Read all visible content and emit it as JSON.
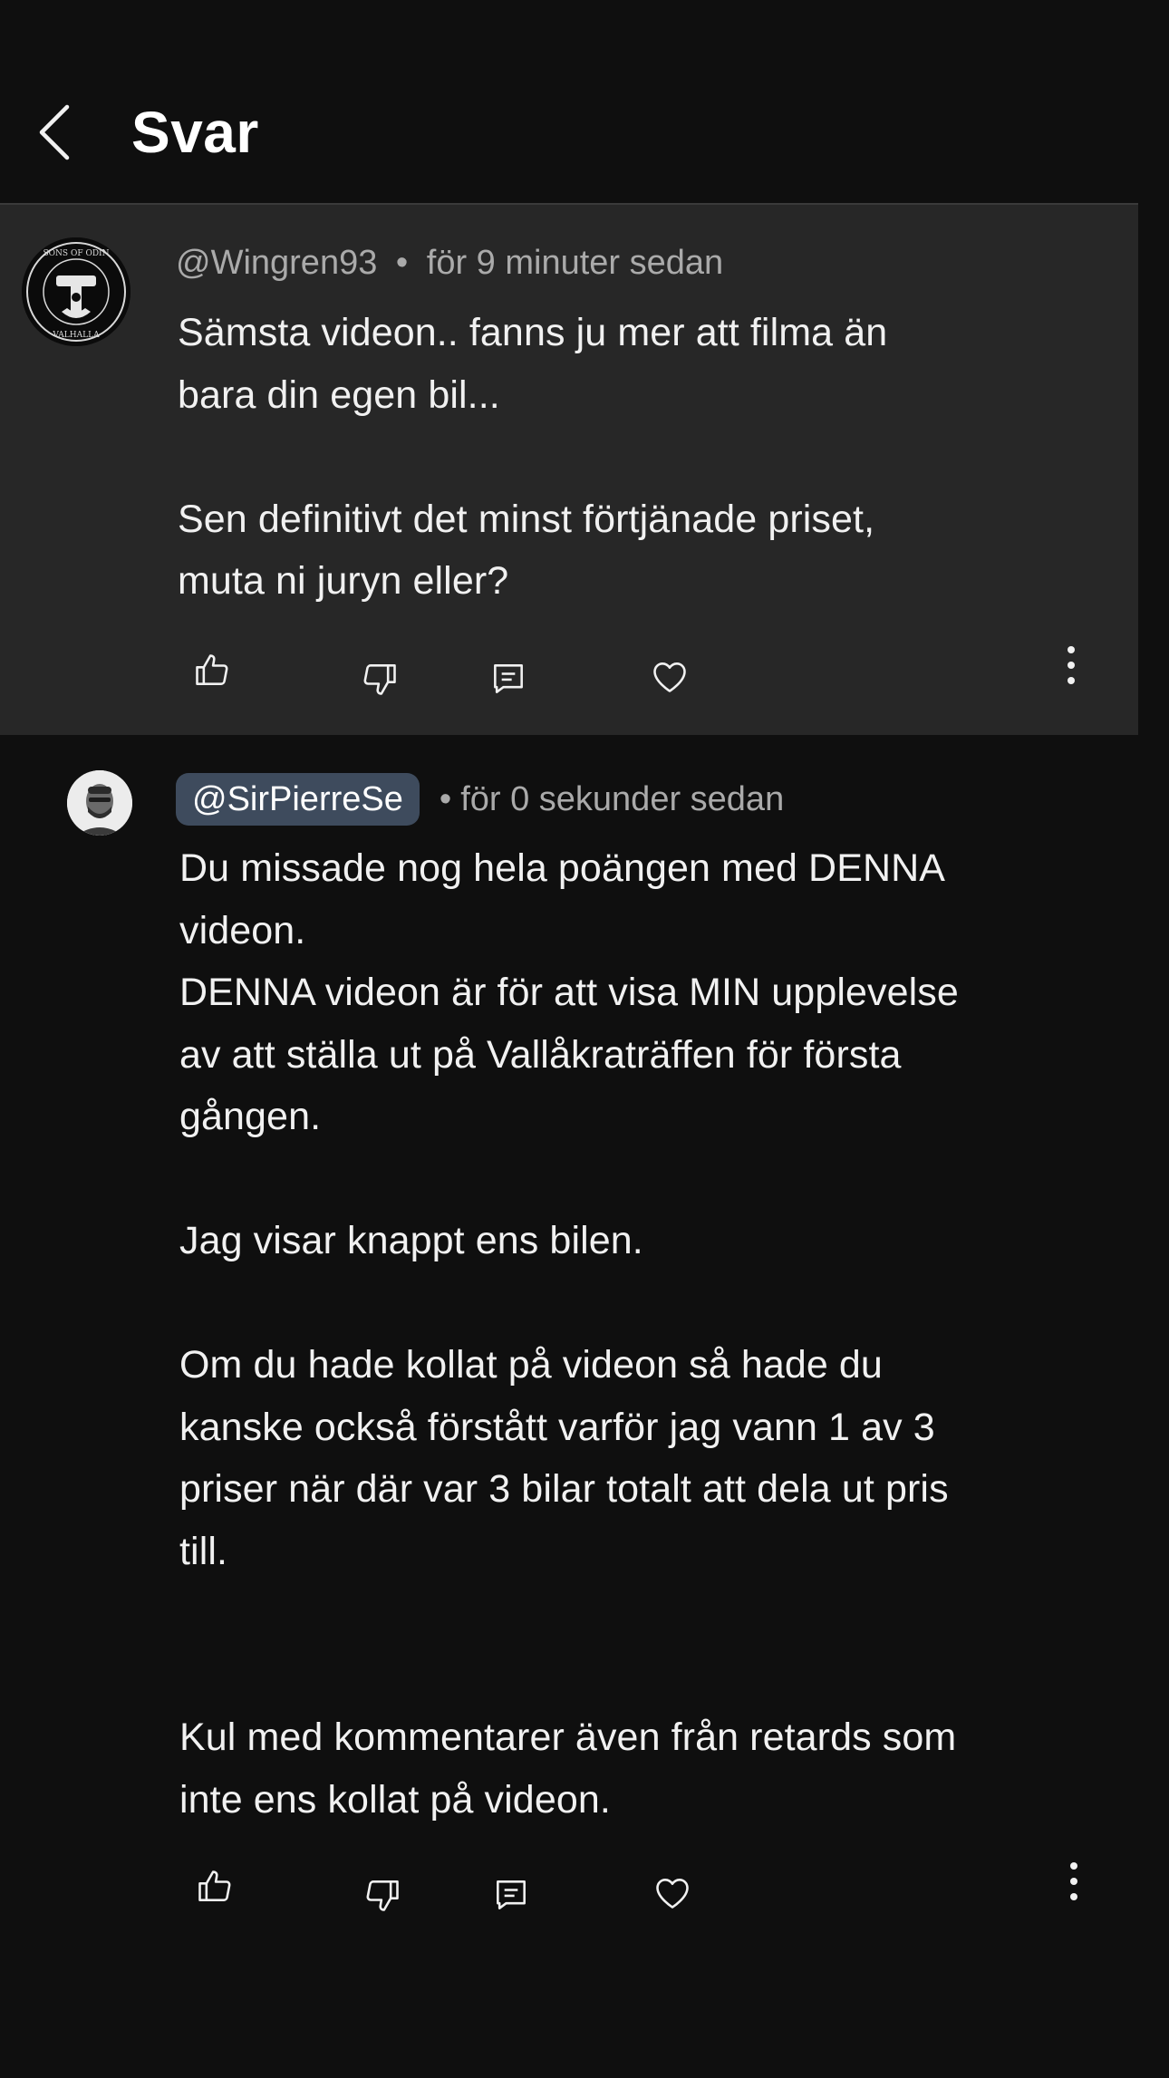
{
  "header": {
    "title": "Svar",
    "back_icon": "chevron-left-icon"
  },
  "parent_comment": {
    "author": "@Wingren93",
    "separator": "•",
    "timestamp": "för 9 minuter sedan",
    "text": "Sämsta videon.. fanns ju mer att filma än\nbara din egen bil...\n\nSen definitivt det minst förtjänade priset,\nmuta ni juryn eller?",
    "actions": [
      "thumb-up-icon",
      "thumb-down-icon",
      "reply-icon",
      "heart-icon",
      "more-vertical-icon"
    ]
  },
  "reply": {
    "author": "@SirPierreSe",
    "separator": "•",
    "timestamp": "för 0 sekunder sedan",
    "text": "Du missade nog hela poängen med DENNA\nvideon.\nDENNA videon är för att visa MIN upplevelse\nav att ställa ut på Vallåkraträffen för första\ngången.\n\nJag visar knappt ens bilen.\n\nOm du hade kollat på videon så hade du\nkanske också förstått varför jag vann 1 av 3\npriser när där var 3 bilar totalt att dela ut pris\ntill.\n\n\nKul med kommentarer även från retards som\ninte ens kollat på videon.",
    "actions": [
      "thumb-up-icon",
      "thumb-down-icon",
      "reply-icon",
      "heart-icon",
      "more-vertical-icon"
    ]
  },
  "colors": {
    "background": "#0f0f0f",
    "highlight_background": "#272727",
    "handle_chip": "#3e4b5d",
    "meta_text": "#aaaaaa",
    "body_text": "#f1f1f1"
  }
}
